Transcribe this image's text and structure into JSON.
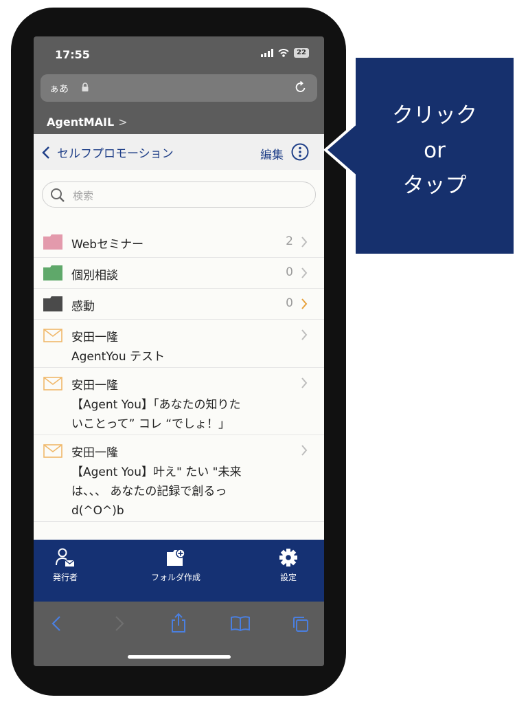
{
  "status_bar": {
    "time": "17:55",
    "battery": "22"
  },
  "url_bar": {
    "text_size": "ぁあ"
  },
  "site_header": {
    "title": "AgentMAIL",
    "chevron": ">"
  },
  "nav": {
    "back_label": "セルフプロモーション",
    "edit_label": "編集"
  },
  "search": {
    "placeholder": "検索"
  },
  "folders": [
    {
      "name": "Webセミナー",
      "count": "2",
      "color": "#e39aac",
      "arrow_color": "#bdbdbd"
    },
    {
      "name": "個別相談",
      "count": "0",
      "color": "#5fa86a",
      "arrow_color": "#bdbdbd"
    },
    {
      "name": "感動",
      "count": "0",
      "color": "#4a4a4a",
      "arrow_color": "#e7a13c"
    }
  ],
  "messages": [
    {
      "sender": "安田一隆",
      "subject": "AgentYou テスト"
    },
    {
      "sender": "安田一隆",
      "subject": "【Agent You】「あなたの知りた\nいことって” コレ “でしょ！」"
    },
    {
      "sender": "安田一隆",
      "subject": "【Agent You】叶え\" たい \"未来\nは、、、 あなたの記録で創るっ\nd(^O^)b"
    }
  ],
  "tab_bar": {
    "publisher": "発行者",
    "create_folder": "フォルダ作成",
    "settings": "設定"
  },
  "callout": {
    "line1": "クリック",
    "line2": "or",
    "line3": "タップ"
  },
  "colors": {
    "accent": "#1f3f88",
    "tab_bar_bg": "#153173",
    "callout_bg": "#16306d",
    "envelope": "#f0b86a"
  }
}
